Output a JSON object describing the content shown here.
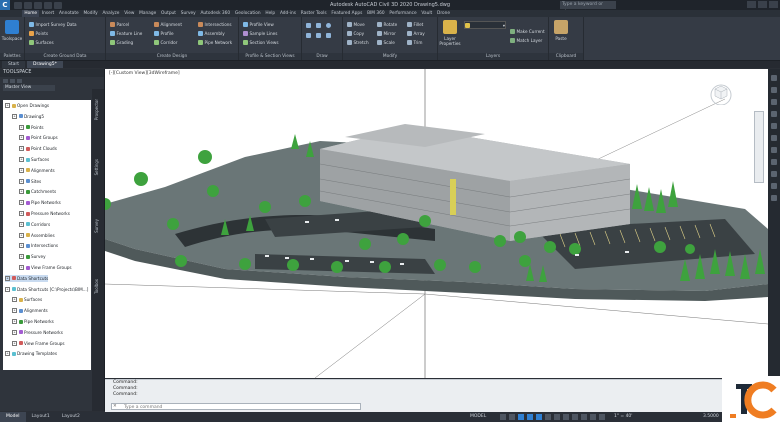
{
  "app": {
    "logo_letter": "C",
    "window_title": "Autodesk AutoCAD Civil 3D 2020   Drawing5.dwg",
    "search_placeholder": "Type a keyword or phrase",
    "watermark_text": "TC"
  },
  "ribbon_tabs": [
    "Home",
    "Insert",
    "Annotate",
    "Modify",
    "Analyze",
    "View",
    "Manage",
    "Output",
    "Survey",
    "Autodesk 360",
    "Geolocation",
    "Help",
    "Add-ins",
    "Raster Tools",
    "Featured Apps",
    "BIM 360",
    "Performance",
    "Vault",
    "Drone"
  ],
  "ribbon_active_tab": "Home",
  "ribbon": {
    "toolspace_big": "Toolspace",
    "palettes_title": "Palettes",
    "ground_items": [
      "Import Survey Data",
      "Points",
      "Surfaces"
    ],
    "ground_title": "Create Ground Data",
    "design_items": [
      "Parcel",
      "Feature Line",
      "Grading",
      "Alignment",
      "Profile",
      "Corridor",
      "Intersections",
      "Assembly",
      "Pipe Network"
    ],
    "design_title": "Create Design",
    "profile_items": [
      "Profile View",
      "Sample Lines",
      "Section Views"
    ],
    "profile_title": "Profile & Section Views",
    "draw_title": "Draw",
    "modify_items": [
      "Move",
      "Copy",
      "Stretch",
      "Rotate",
      "Mirror",
      "Scale",
      "Fillet",
      "Array",
      "Trim"
    ],
    "modify_title": "Modify",
    "layer_big": "Layer Properties",
    "layer_items": [
      "Make Current",
      "Match Layer"
    ],
    "layers_title": "Layers",
    "paste_big": "Paste",
    "clipboard_title": "Clipboard"
  },
  "file_tabs": [
    "Start",
    "Drawing5*"
  ],
  "file_active_tab": "Drawing5*",
  "toolspace": {
    "title": "TOOLSPACE",
    "view_select": "Master View",
    "tree": [
      {
        "label": "Open Drawings",
        "level": 0,
        "icon": "folder-icon"
      },
      {
        "label": "Drawing5",
        "level": 1,
        "icon": "drawing-icon"
      },
      {
        "label": "Points",
        "level": 2,
        "icon": "points-icon"
      },
      {
        "label": "Point Groups",
        "level": 2,
        "icon": "point-groups-icon"
      },
      {
        "label": "Point Clouds",
        "level": 2,
        "icon": "point-clouds-icon"
      },
      {
        "label": "Surfaces",
        "level": 2,
        "icon": "surfaces-icon"
      },
      {
        "label": "Alignments",
        "level": 2,
        "icon": "alignments-icon"
      },
      {
        "label": "Sites",
        "level": 2,
        "icon": "sites-icon"
      },
      {
        "label": "Catchments",
        "level": 2,
        "icon": "catchments-icon"
      },
      {
        "label": "Pipe Networks",
        "level": 2,
        "icon": "pipe-networks-icon"
      },
      {
        "label": "Pressure Networks",
        "level": 2,
        "icon": "pressure-networks-icon"
      },
      {
        "label": "Corridors",
        "level": 2,
        "icon": "corridors-icon"
      },
      {
        "label": "Assemblies",
        "level": 2,
        "icon": "assemblies-icon"
      },
      {
        "label": "Intersections",
        "level": 2,
        "icon": "intersections-icon"
      },
      {
        "label": "Survey",
        "level": 2,
        "icon": "survey-icon"
      },
      {
        "label": "View Frame Groups",
        "level": 2,
        "icon": "view-frame-icon"
      },
      {
        "label": "Data Shortcuts",
        "level": 0,
        "icon": "folder-icon",
        "selected": true
      },
      {
        "label": "Data Shortcuts [C:\\Projects\\BIM...]",
        "level": 0,
        "icon": "folder-icon"
      },
      {
        "label": "Surfaces",
        "level": 1,
        "icon": "surfaces-icon"
      },
      {
        "label": "Alignments",
        "level": 1,
        "icon": "alignments-icon"
      },
      {
        "label": "Pipe Networks",
        "level": 1,
        "icon": "pipe-networks-icon"
      },
      {
        "label": "Pressure Networks",
        "level": 1,
        "icon": "pressure-networks-icon"
      },
      {
        "label": "View Frame Groups",
        "level": 1,
        "icon": "view-frame-icon"
      },
      {
        "label": "Drawing Templates",
        "level": 0,
        "icon": "folder-icon"
      }
    ],
    "side_tabs": [
      "Prospector",
      "Settings",
      "Survey",
      "Toolbox"
    ]
  },
  "viewport": {
    "label": "[-][Custom View][3dWireframe]"
  },
  "command_line": {
    "history": [
      "Command:",
      "Command:",
      "Command:"
    ],
    "placeholder": "Type a command"
  },
  "statusbar": {
    "layout_tabs": [
      "Model",
      "Layout1",
      "Layout2"
    ],
    "active_layout": "Model",
    "coords": "MODEL",
    "scale": "1\" = 40'",
    "zoom": "3.5000"
  },
  "colors": {
    "accent": "#2a6fb0",
    "tree_green": "#3a9a3a",
    "building_gray": "#a5a9ab",
    "terrain": "#6f7a7a"
  }
}
